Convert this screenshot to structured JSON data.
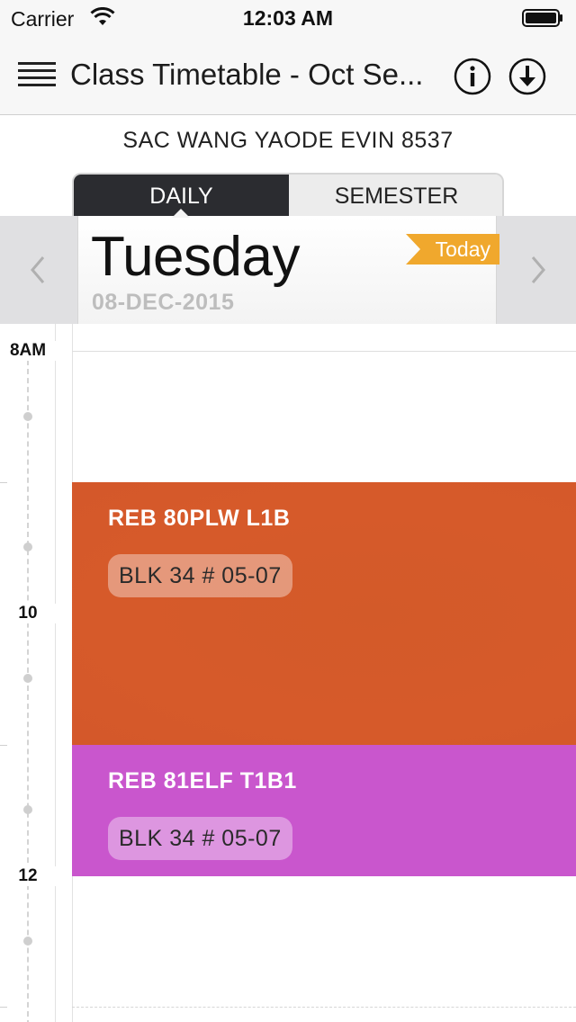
{
  "status_bar": {
    "carrier": "Carrier",
    "time": "12:03 AM"
  },
  "nav": {
    "title": "Class Timetable - Oct Se...",
    "icons": [
      "menu-icon",
      "info-icon",
      "download-icon"
    ]
  },
  "student": {
    "name": "SAC WANG YAODE EVIN 8537"
  },
  "tabs": [
    {
      "label": "DAILY",
      "active": true
    },
    {
      "label": "SEMESTER",
      "active": false
    }
  ],
  "day": {
    "name": "Tuesday",
    "date": "08-DEC-2015",
    "today_label": "Today"
  },
  "timeline": {
    "hours": [
      "8AM",
      "10",
      "12"
    ]
  },
  "classes": [
    {
      "code": "REB 80PLW L1B",
      "venue": "BLK 34 # 05-07",
      "color": "#d65a2a"
    },
    {
      "code": "REB 81ELF T1B1",
      "venue": "BLK 34 # 05-07",
      "color": "#c956cd"
    }
  ],
  "colors": {
    "segment_active": "#2b2c30",
    "today_ribbon": "#f0a82d"
  }
}
